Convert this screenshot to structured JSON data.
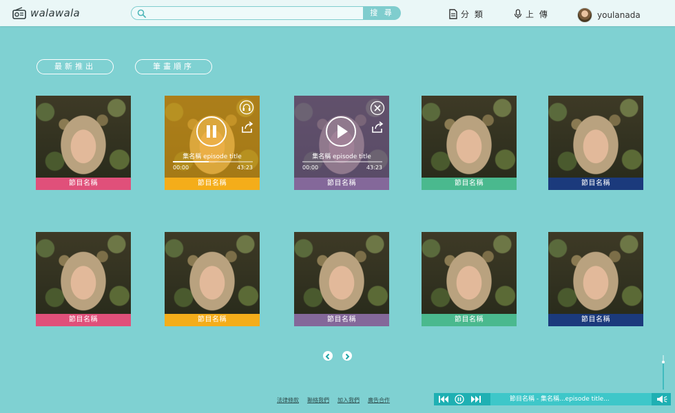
{
  "app": {
    "name": "walawala"
  },
  "search": {
    "placeholder": "",
    "button_label": "搜 尋"
  },
  "nav": {
    "category_label": "分 類",
    "upload_label": "上 傳"
  },
  "user": {
    "name": "youlanada"
  },
  "sort": {
    "latest_label": "最新推出",
    "stroke_label": "筆畫順序"
  },
  "cards": [
    {
      "label": "節目名稱",
      "color": "#e0507a"
    },
    {
      "label": "節目名稱",
      "color": "#f4ad1a",
      "state": "playing",
      "episode_title": "集名稱 episode title",
      "time_start": "00:00",
      "time_end": "43:23",
      "progress": 0.45
    },
    {
      "label": "節目名稱",
      "color": "#84689a",
      "state": "paused",
      "episode_title": "集名稱 episode title",
      "time_start": "00:00",
      "time_end": "43:23",
      "progress": 0.0
    },
    {
      "label": "節目名稱",
      "color": "#4ab98e"
    },
    {
      "label": "節目名稱",
      "color": "#1b3a7c"
    },
    {
      "label": "節目名稱",
      "color": "#e0507a"
    },
    {
      "label": "節目名稱",
      "color": "#f4ad1a"
    },
    {
      "label": "節目名稱",
      "color": "#84689a"
    },
    {
      "label": "節目名稱",
      "color": "#4ab98e"
    },
    {
      "label": "節目名稱",
      "color": "#1b3a7c"
    }
  ],
  "footer": {
    "links": [
      "法律條款",
      "聯絡我們",
      "加入我們",
      "廣告合作"
    ]
  },
  "player": {
    "now_playing": "節目名稱 - 集名稱...episode title...",
    "volume": 0.8
  },
  "colors": {
    "background": "#7fd1d2",
    "header": "#eaf7f7",
    "accent": "#7fcdce",
    "player": "#1fb0b3"
  }
}
